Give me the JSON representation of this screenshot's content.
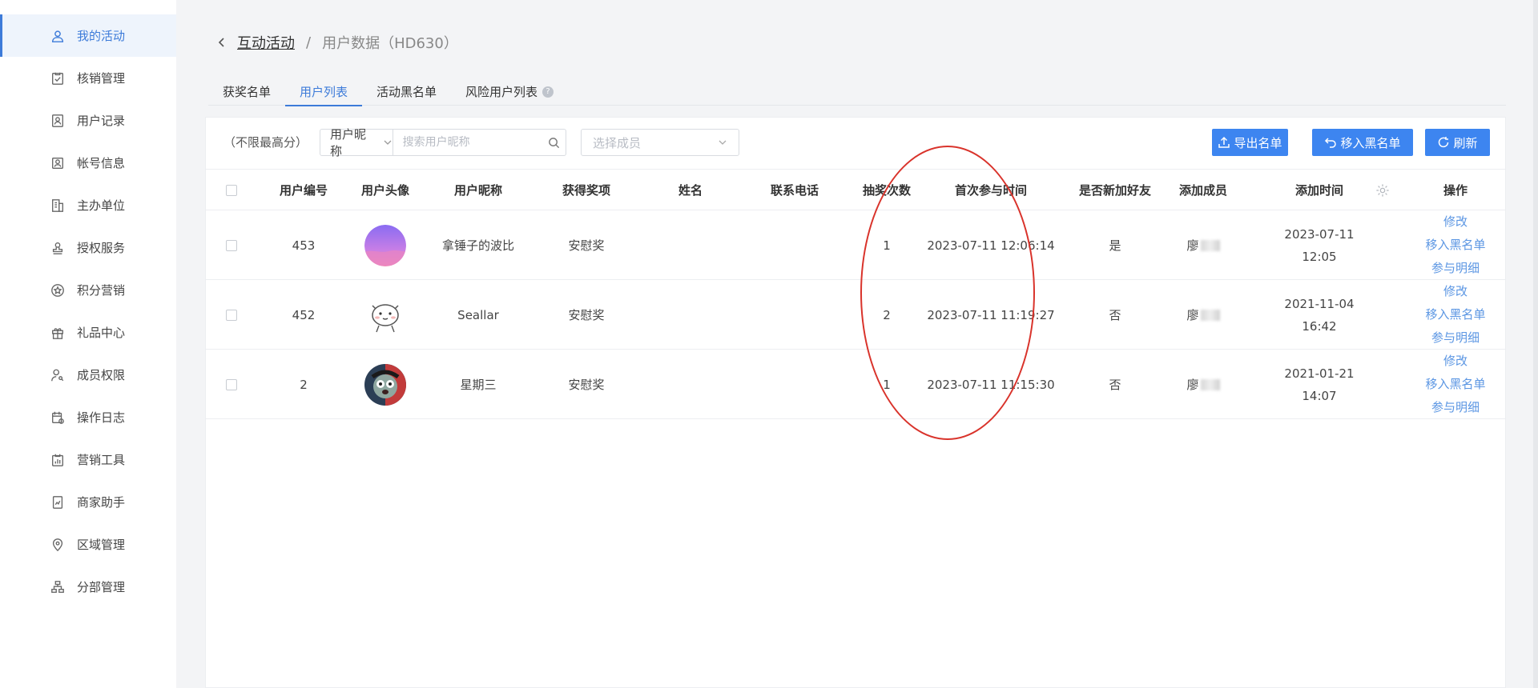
{
  "sidebar": {
    "items": [
      {
        "label": "我的活动",
        "icon": "user-icon",
        "active": true
      },
      {
        "label": "核销管理",
        "icon": "clipboard-check-icon"
      },
      {
        "label": "用户记录",
        "icon": "user-record-icon"
      },
      {
        "label": "帐号信息",
        "icon": "account-icon"
      },
      {
        "label": "主办单位",
        "icon": "building-icon"
      },
      {
        "label": "授权服务",
        "icon": "stamp-icon"
      },
      {
        "label": "积分营销",
        "icon": "star-circle-icon"
      },
      {
        "label": "礼品中心",
        "icon": "gift-icon"
      },
      {
        "label": "成员权限",
        "icon": "user-key-icon"
      },
      {
        "label": "操作日志",
        "icon": "calendar-log-icon"
      },
      {
        "label": "营销工具",
        "icon": "chart-tool-icon"
      },
      {
        "label": "商家助手",
        "icon": "phone-assist-icon"
      },
      {
        "label": "区域管理",
        "icon": "location-icon"
      },
      {
        "label": "分部管理",
        "icon": "org-tree-icon"
      }
    ]
  },
  "breadcrumb": {
    "parent": "互动活动",
    "separator": "/",
    "current": "用户数据（HD630）"
  },
  "tabs": [
    {
      "label": "获奖名单",
      "active": false
    },
    {
      "label": "用户列表",
      "active": true
    },
    {
      "label": "活动黑名单",
      "active": false
    },
    {
      "label": "风险用户列表",
      "active": false,
      "help": "?"
    }
  ],
  "toolbar": {
    "score_label": "（不限最高分）",
    "search_select": "用户昵称",
    "search_placeholder": "搜索用户昵称",
    "member_placeholder": "选择成员",
    "export_label": "导出名单",
    "blacklist_label": "移入黑名单",
    "refresh_label": "刷新"
  },
  "table": {
    "columns": [
      "用户编号",
      "用户头像",
      "用户昵称",
      "获得奖项",
      "姓名",
      "联系电话",
      "抽奖次数",
      "首次参与时间",
      "是否新加好友",
      "添加成员",
      "添加时间",
      "操作"
    ],
    "rows": [
      {
        "id": "453",
        "avatar": "purple-gradient",
        "nickname": "拿锤子的波比",
        "prize": "安慰奖",
        "name": "",
        "phone": "",
        "draws": "1",
        "first_time": "2023-07-11 12:06:14",
        "new_friend": "是",
        "member": "廖",
        "add_time": "2023-07-11 12:05",
        "ops": [
          "修改",
          "移入黑名单",
          "参与明细"
        ]
      },
      {
        "id": "452",
        "avatar": "cat-face",
        "nickname": "Seallar",
        "prize": "安慰奖",
        "name": "",
        "phone": "",
        "draws": "2",
        "first_time": "2023-07-11 11:19:27",
        "new_friend": "否",
        "member": "廖",
        "add_time": "2021-11-04 16:42",
        "ops": [
          "修改",
          "移入黑名单",
          "参与明细"
        ]
      },
      {
        "id": "2",
        "avatar": "cartoon-face",
        "nickname": "星期三",
        "prize": "安慰奖",
        "name": "",
        "phone": "",
        "draws": "1",
        "first_time": "2023-07-11 11:15:30",
        "new_friend": "否",
        "member": "廖",
        "add_time": "2021-01-21 14:07",
        "ops": [
          "修改",
          "移入黑名单",
          "参与明细"
        ]
      }
    ]
  },
  "colors": {
    "accent": "#3d7bd9",
    "button": "#3d85f0",
    "link": "#5b96e3",
    "annotation": "#d9332b"
  }
}
